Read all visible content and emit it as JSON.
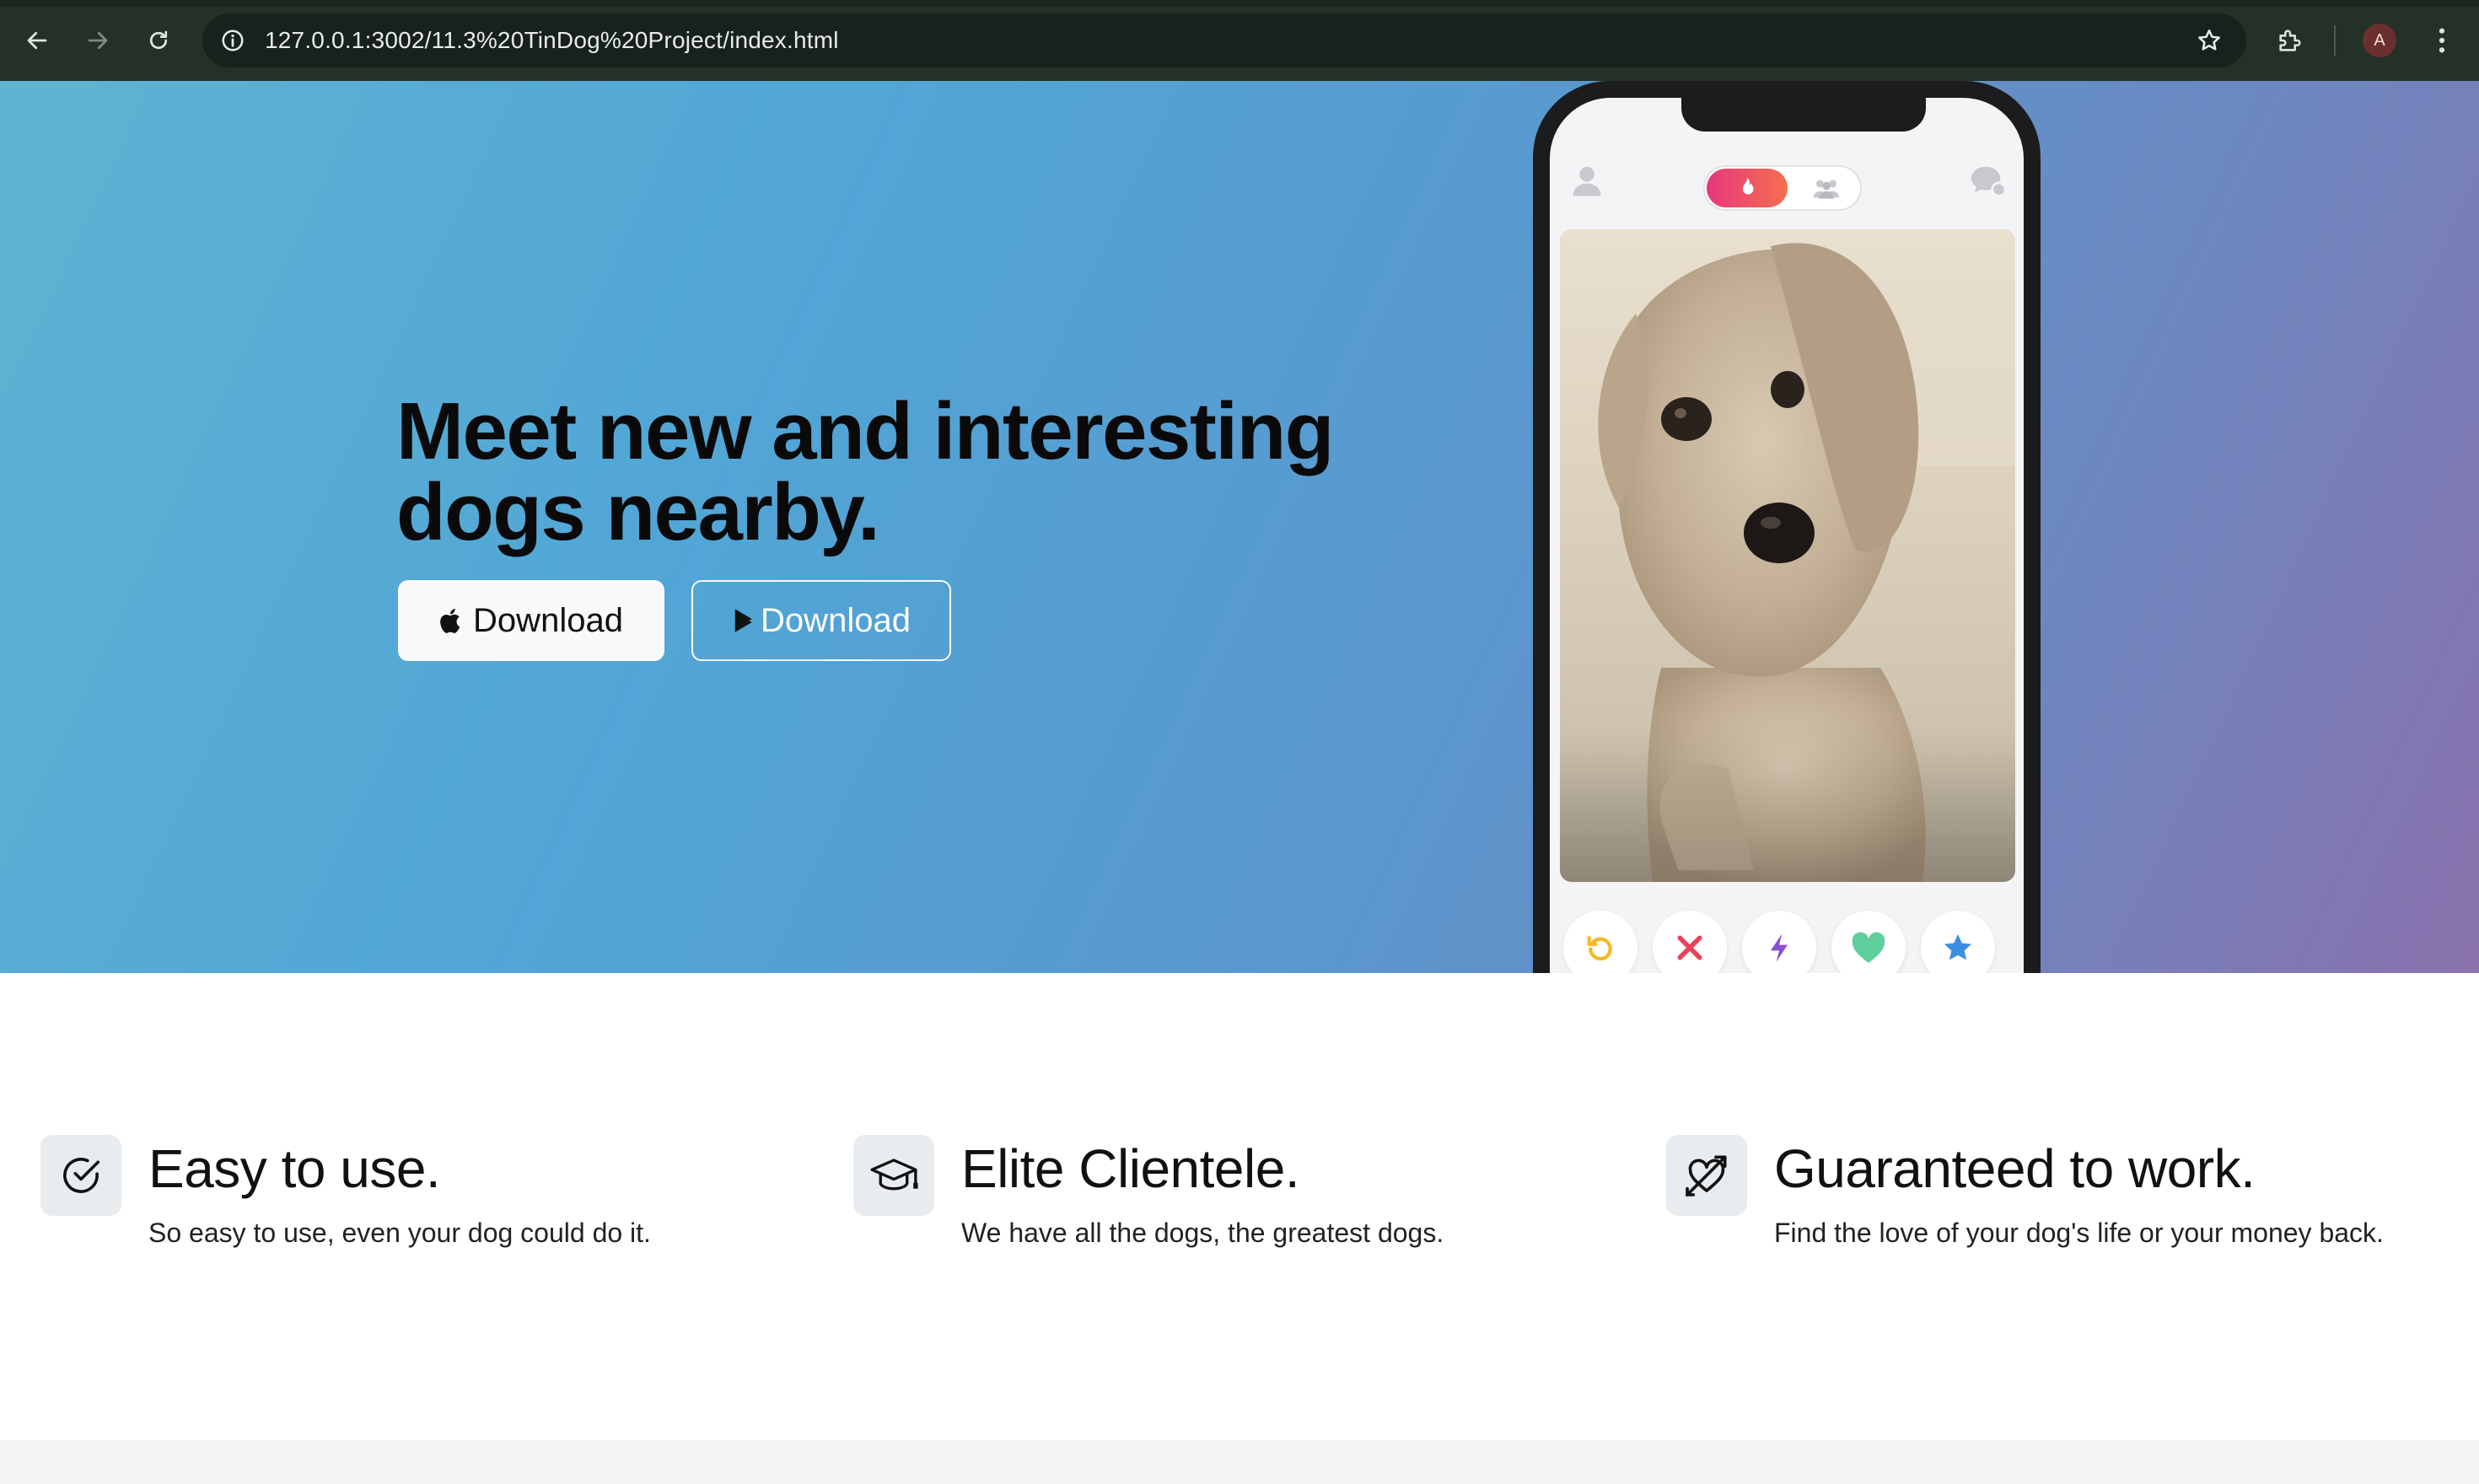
{
  "browser": {
    "url": "127.0.0.1:3002/11.3%20TinDog%20Project/index.html",
    "profile_initial": "A",
    "icons": [
      "back-arrow-icon",
      "forward-arrow-icon",
      "reload-icon",
      "info-icon",
      "star-icon",
      "extensions-icon",
      "kebab-menu-icon"
    ]
  },
  "hero": {
    "title": "Meet new and interesting dogs nearby.",
    "buttons": [
      {
        "label": "Download",
        "icon": "apple-icon",
        "style": "light"
      },
      {
        "label": "Download",
        "icon": "google-play-icon",
        "style": "outline"
      }
    ],
    "gradient_colors": [
      "#5fb3d2",
      "#51a6d6",
      "#6e86bf",
      "#8a72ad"
    ]
  },
  "phone_app": {
    "top_icons": [
      "user-icon",
      "flame-icon",
      "people-icon",
      "chat-icon"
    ],
    "actions": [
      {
        "name": "rewind",
        "icon": "rewind-icon",
        "color": "#f5b928"
      },
      {
        "name": "nope",
        "icon": "x-icon",
        "color": "#e8425a"
      },
      {
        "name": "boost",
        "icon": "bolt-icon",
        "color": "#8a4fd1"
      },
      {
        "name": "like",
        "icon": "heart-icon",
        "color": "#5fcf9e"
      },
      {
        "name": "super-like",
        "icon": "star-icon",
        "color": "#3b8fe0"
      }
    ]
  },
  "features": [
    {
      "title": "Easy to use.",
      "text": "So easy to use, even your dog could do it.",
      "icon": "check-circle-icon"
    },
    {
      "title": "Elite Clientele.",
      "text": "We have all the dogs, the greatest dogs.",
      "icon": "graduation-cap-icon"
    },
    {
      "title": "Guaranteed to work.",
      "text": "Find the love of your dog's life or your money back.",
      "icon": "heart-arrow-icon"
    }
  ]
}
